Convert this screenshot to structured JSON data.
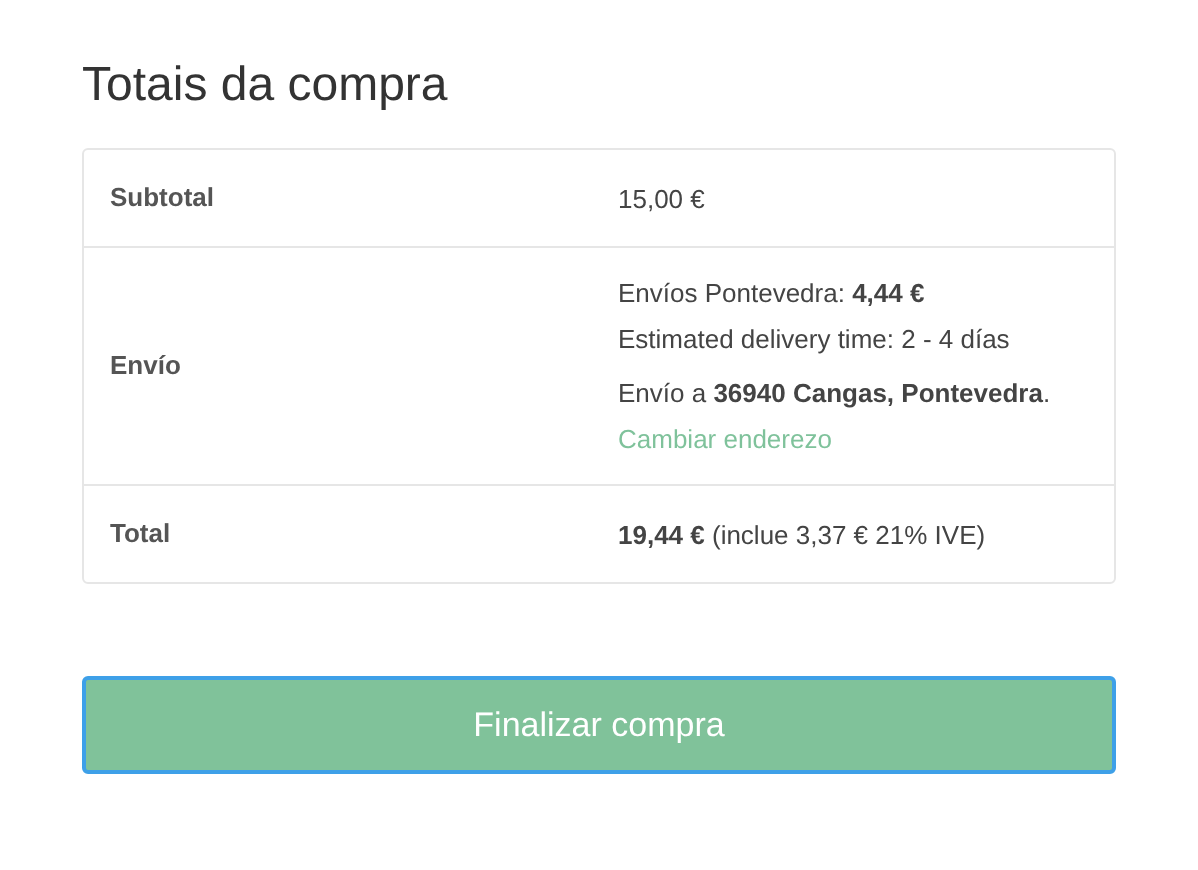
{
  "title": "Totais da compra",
  "rows": [
    {
      "label": "Subtotal",
      "lines": [
        "15,00 €"
      ]
    },
    {
      "label": "Envío",
      "lines": [
        "Envíos Pontevedra: **4,44 €**",
        "Estimated delivery time: 2 - 4 días"
      ],
      "address": "Envío a **36940 Cangas, Pontevedra**.",
      "link": "Cambiar enderezo"
    },
    {
      "label": "Total",
      "lines": [
        "**19,44 €** (inclue 3,37 € 21% IVE)"
      ]
    }
  ],
  "button": "Finalizar compra"
}
